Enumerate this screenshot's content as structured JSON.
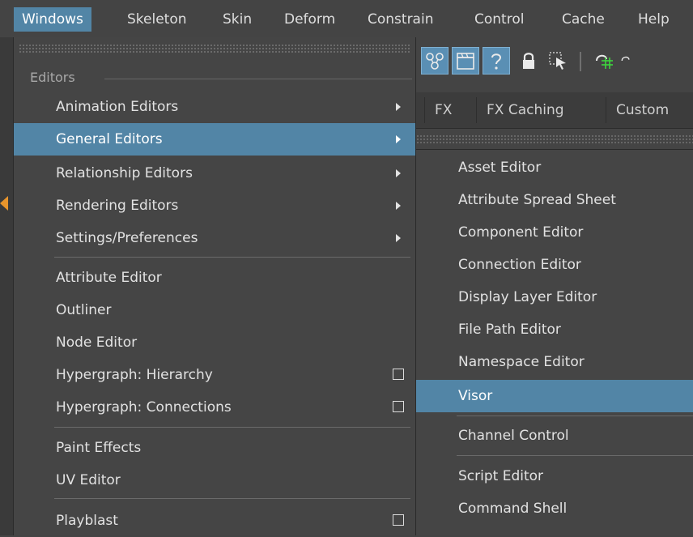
{
  "menubar": {
    "items": [
      {
        "label": "Windows",
        "active": true
      },
      {
        "label": "Skeleton"
      },
      {
        "label": "Skin"
      },
      {
        "label": "Deform"
      },
      {
        "label": "Constrain"
      },
      {
        "label": "Control"
      },
      {
        "label": "Cache"
      },
      {
        "label": "Help"
      }
    ]
  },
  "shelf": {
    "tabs": [
      "FX",
      "FX Caching",
      "Custom"
    ]
  },
  "toolbar": {
    "icons": [
      "node-graph-icon",
      "clapperboard-icon",
      "help-icon",
      "lock-icon",
      "select-icon",
      "snap-icon"
    ]
  },
  "windows_menu": {
    "section_label": "Editors",
    "items": [
      {
        "label": "Animation Editors",
        "submenu": true
      },
      {
        "label": "General Editors",
        "submenu": true,
        "highlighted": true
      },
      {
        "label": "Relationship Editors",
        "submenu": true
      },
      {
        "label": "Rendering Editors",
        "submenu": true
      },
      {
        "label": "Settings/Preferences",
        "submenu": true
      },
      {
        "label": "Attribute Editor"
      },
      {
        "label": "Outliner"
      },
      {
        "label": "Node Editor"
      },
      {
        "label": "Hypergraph: Hierarchy",
        "option_box": true
      },
      {
        "label": "Hypergraph: Connections",
        "option_box": true
      },
      {
        "label": "Paint Effects"
      },
      {
        "label": "UV Editor"
      },
      {
        "label": "Playblast",
        "option_box": true
      }
    ]
  },
  "general_editors_submenu": {
    "items": [
      {
        "label": "Asset Editor"
      },
      {
        "label": "Attribute Spread Sheet"
      },
      {
        "label": "Component Editor"
      },
      {
        "label": "Connection Editor"
      },
      {
        "label": "Display Layer Editor"
      },
      {
        "label": "File Path Editor"
      },
      {
        "label": "Namespace Editor"
      },
      {
        "label": "Visor",
        "highlighted": true
      },
      {
        "label": "Channel Control"
      },
      {
        "label": "Script Editor"
      },
      {
        "label": "Command Shell"
      }
    ]
  },
  "colors": {
    "highlight": "#5285a6",
    "menu_bg": "#454545",
    "text": "#e2e2e2"
  }
}
